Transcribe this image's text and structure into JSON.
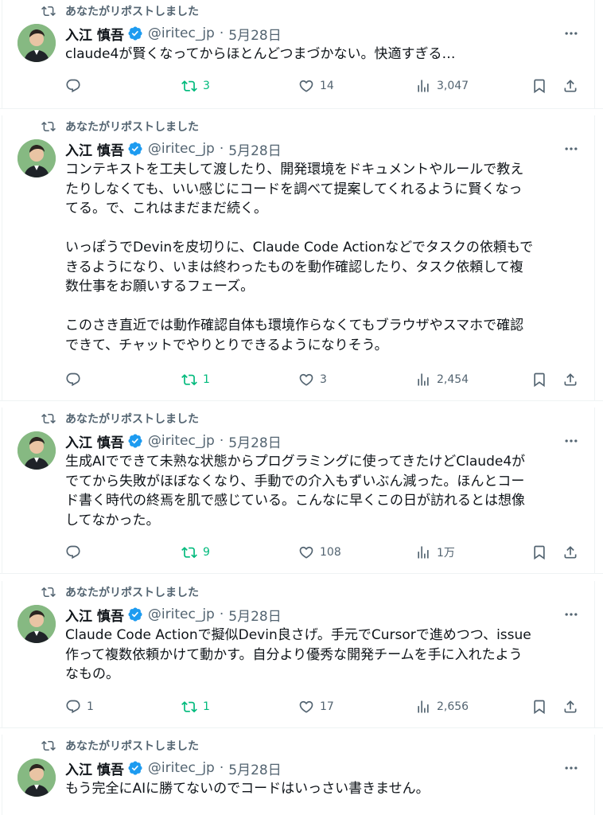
{
  "feed": {
    "posts": [
      {
        "repost_label": "あなたがリポストしました",
        "name": "入江 慎吾",
        "handle": "@iritec_jp",
        "sep": "·",
        "date": "5月28日",
        "text": "claude4が賢くなってからほとんどつまづかない。快適すぎる…",
        "replies": "",
        "reposts": "3",
        "likes": "14",
        "views": "3,047"
      },
      {
        "repost_label": "あなたがリポストしました",
        "name": "入江 慎吾",
        "handle": "@iritec_jp",
        "sep": "·",
        "date": "5月28日",
        "text": "コンテキストを工夫して渡したり、開発環境をドキュメントやルールで教え\nたりしなくても、いい感じにコードを調べて提案してくれるように賢くなっ\nてる。で、これはまだまだ続く。\n\nいっぽうでDevinを皮切りに、Claude Code Actionなどでタスクの依頼もで\nきるようになり、いまは終わったものを動作確認したり、タスク依頼して複\n数仕事をお願いするフェーズ。\n\nこのさき直近では動作確認自体も環境作らなくてもブラウザやスマホで確認\nできて、チャットでやりとりできるようになりそう。",
        "replies": "",
        "reposts": "1",
        "likes": "3",
        "views": "2,454"
      },
      {
        "repost_label": "あなたがリポストしました",
        "name": "入江 慎吾",
        "handle": "@iritec_jp",
        "sep": "·",
        "date": "5月28日",
        "text": "生成AIでできて未熟な状態からプログラミングに使ってきたけどClaude4が\nでてから失敗がほぼなくなり、手動での介入もずいぶん減った。ほんとコー\nド書く時代の終焉を肌で感じている。こんなに早くこの日が訪れるとは想像\nしてなかった。",
        "replies": "",
        "reposts": "9",
        "likes": "108",
        "views": "1万"
      },
      {
        "repost_label": "あなたがリポストしました",
        "name": "入江 慎吾",
        "handle": "@iritec_jp",
        "sep": "·",
        "date": "5月28日",
        "text": "Claude Code Actionで擬似Devin良さげ。手元でCursorで進めつつ、issue\n作って複数依頼かけて動かす。自分より優秀な開発チームを手に入れたよう\nなもの。",
        "replies": "1",
        "reposts": "1",
        "likes": "17",
        "views": "2,656"
      },
      {
        "repost_label": "あなたがリポストしました",
        "name": "入江 慎吾",
        "handle": "@iritec_jp",
        "sep": "·",
        "date": "5月28日",
        "text": "もう完全にAIに勝てないのでコードはいっさい書きません。"
      }
    ]
  },
  "colors": {
    "text": "#0f1419",
    "muted": "#536471",
    "repost_green": "#00ba7c",
    "verified_blue": "#1d9bf0",
    "divider": "#eff3f4"
  },
  "icons": {
    "repost": "repost-icon",
    "verified": "verified-badge-icon",
    "more": "more-icon",
    "reply": "reply-icon",
    "like": "like-icon",
    "views": "views-icon",
    "bookmark": "bookmark-icon",
    "share": "share-icon"
  }
}
